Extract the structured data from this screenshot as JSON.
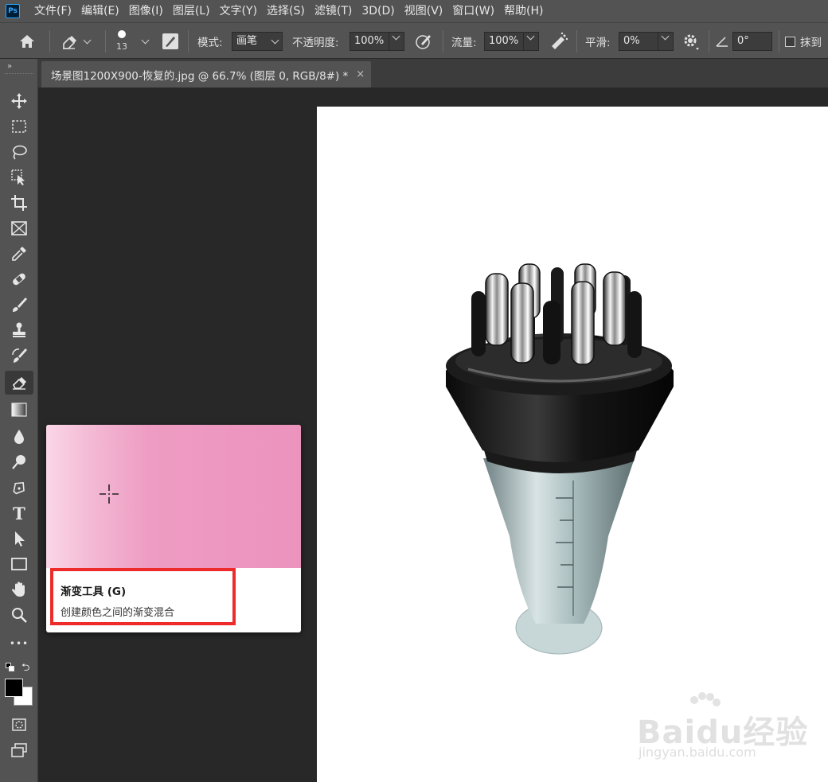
{
  "app": {
    "logo_text": "Ps"
  },
  "menu": [
    "文件(F)",
    "编辑(E)",
    "图像(I)",
    "图层(L)",
    "文字(Y)",
    "选择(S)",
    "滤镜(T)",
    "3D(D)",
    "视图(V)",
    "窗口(W)",
    "帮助(H)"
  ],
  "options": {
    "brush_size": "13",
    "mode_label": "模式:",
    "mode_value": "画笔",
    "opacity_label": "不透明度:",
    "opacity_value": "100%",
    "flow_label": "流量:",
    "flow_value": "100%",
    "smooth_label": "平滑:",
    "smooth_value": "0%",
    "angle_value": "0°",
    "erase_history_label": "抹到"
  },
  "toolbar": {
    "collapse_glyph": "»",
    "tools": [
      "move-tool",
      "marquee-tool",
      "lasso-tool",
      "object-select-tool",
      "crop-tool",
      "frame-tool",
      "eyedropper-tool",
      "healing-tool",
      "brush-tool",
      "stamp-tool",
      "history-brush-tool",
      "eraser-tool",
      "gradient-tool",
      "blur-tool",
      "dodge-tool",
      "pen-tool",
      "type-tool",
      "path-select-tool",
      "rectangle-tool",
      "hand-tool",
      "zoom-tool",
      "more-tools"
    ],
    "type_glyph": "T",
    "more_glyph": "•••"
  },
  "document": {
    "tab_title": "场景图1200X900-恢复的.jpg @ 66.7% (图层 0, RGB/8#) *",
    "close_glyph": "×"
  },
  "tooltip": {
    "title": "渐变工具 (G)",
    "description": "创建颜色之间的渐变混合"
  },
  "watermark": {
    "brand": "Baidu经验",
    "sub": "jingyan.baidu.com"
  },
  "colors": {
    "ui_panel": "#535353",
    "canvas_bg": "#282828",
    "highlight": "#ee2b2b",
    "gradient_light": "#fbd6e8",
    "gradient_dark": "#ec93bd"
  }
}
